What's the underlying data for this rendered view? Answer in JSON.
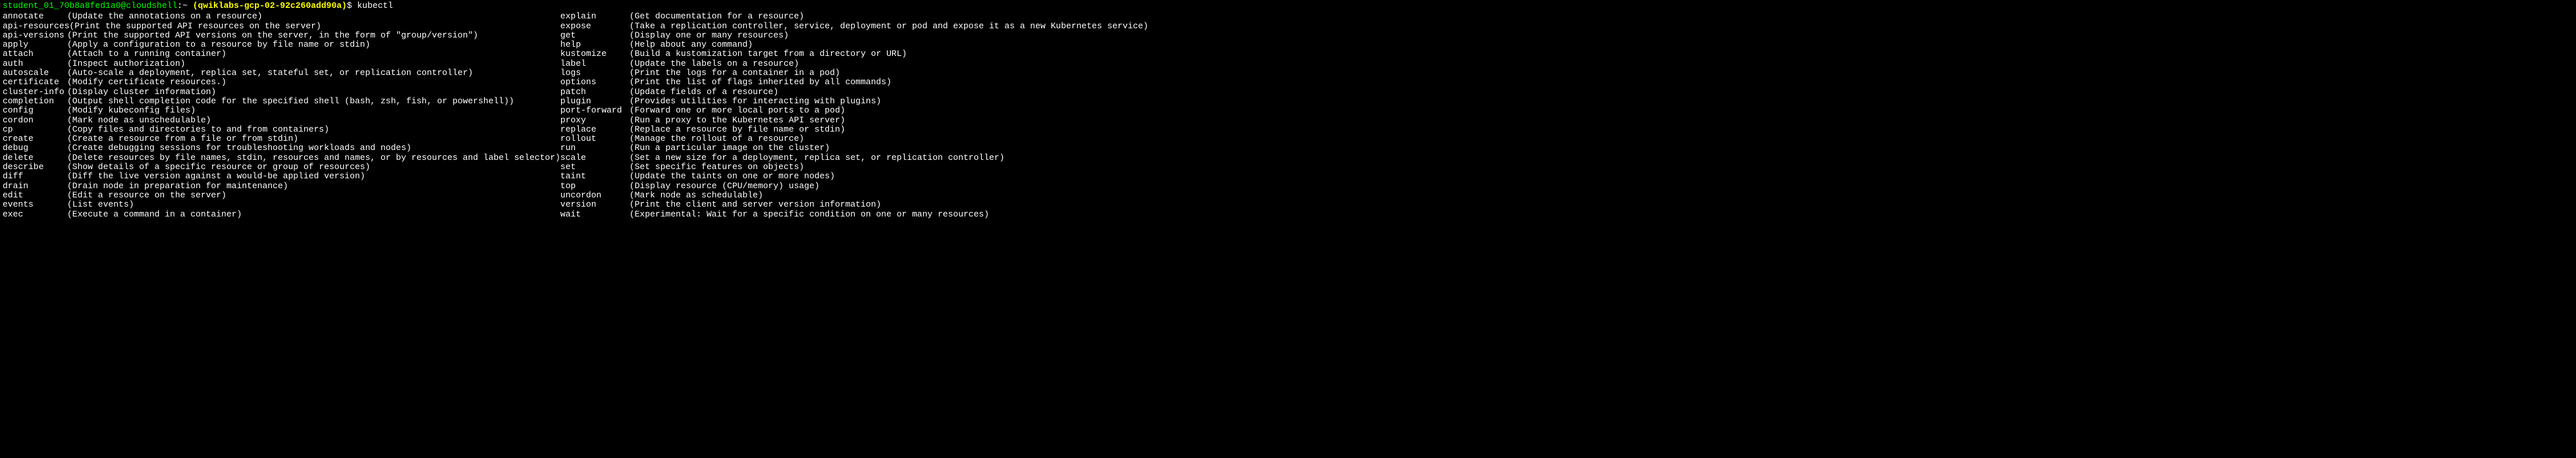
{
  "prompt": {
    "user": "student_01_70b8a8fed1a0@cloudshell",
    "separator": ":",
    "tilde": "~",
    "project": "(qwiklabs-gcp-02-92c260add90a)",
    "dollar": "$",
    "command": "kubectl"
  },
  "left_column": [
    {
      "name": "annotate",
      "desc": "(Update the annotations on a resource)"
    },
    {
      "name": "api-resources",
      "desc": "(Print the supported API resources on the server)"
    },
    {
      "name": "api-versions",
      "desc": "(Print the supported API versions on the server, in the form of \"group/version\")"
    },
    {
      "name": "apply",
      "desc": "(Apply a configuration to a resource by file name or stdin)"
    },
    {
      "name": "attach",
      "desc": "(Attach to a running container)"
    },
    {
      "name": "auth",
      "desc": "(Inspect authorization)"
    },
    {
      "name": "autoscale",
      "desc": "(Auto-scale a deployment, replica set, stateful set, or replication controller)"
    },
    {
      "name": "certificate",
      "desc": "(Modify certificate resources.)"
    },
    {
      "name": "cluster-info",
      "desc": "(Display cluster information)"
    },
    {
      "name": "completion",
      "desc": "(Output shell completion code for the specified shell (bash, zsh, fish, or powershell))"
    },
    {
      "name": "config",
      "desc": "(Modify kubeconfig files)"
    },
    {
      "name": "cordon",
      "desc": "(Mark node as unschedulable)"
    },
    {
      "name": "cp",
      "desc": "(Copy files and directories to and from containers)"
    },
    {
      "name": "create",
      "desc": "(Create a resource from a file or from stdin)"
    },
    {
      "name": "debug",
      "desc": "(Create debugging sessions for troubleshooting workloads and nodes)"
    },
    {
      "name": "delete",
      "desc": "(Delete resources by file names, stdin, resources and names, or by resources and label selector)"
    },
    {
      "name": "describe",
      "desc": "(Show details of a specific resource or group of resources)"
    },
    {
      "name": "diff",
      "desc": "(Diff the live version against a would-be applied version)"
    },
    {
      "name": "drain",
      "desc": "(Drain node in preparation for maintenance)"
    },
    {
      "name": "edit",
      "desc": "(Edit a resource on the server)"
    },
    {
      "name": "events",
      "desc": "(List events)"
    },
    {
      "name": "exec",
      "desc": "(Execute a command in a container)"
    }
  ],
  "right_column": [
    {
      "name": "explain",
      "desc": "(Get documentation for a resource)"
    },
    {
      "name": "expose",
      "desc": "(Take a replication controller, service, deployment or pod and expose it as a new Kubernetes service)"
    },
    {
      "name": "get",
      "desc": "(Display one or many resources)"
    },
    {
      "name": "help",
      "desc": "(Help about any command)"
    },
    {
      "name": "kustomize",
      "desc": "(Build a kustomization target from a directory or URL)"
    },
    {
      "name": "label",
      "desc": "(Update the labels on a resource)"
    },
    {
      "name": "logs",
      "desc": "(Print the logs for a container in a pod)"
    },
    {
      "name": "options",
      "desc": "(Print the list of flags inherited by all commands)"
    },
    {
      "name": "patch",
      "desc": "(Update fields of a resource)"
    },
    {
      "name": "plugin",
      "desc": "(Provides utilities for interacting with plugins)"
    },
    {
      "name": "port-forward",
      "desc": "(Forward one or more local ports to a pod)"
    },
    {
      "name": "proxy",
      "desc": "(Run a proxy to the Kubernetes API server)"
    },
    {
      "name": "replace",
      "desc": "(Replace a resource by file name or stdin)"
    },
    {
      "name": "rollout",
      "desc": "(Manage the rollout of a resource)"
    },
    {
      "name": "run",
      "desc": "(Run a particular image on the cluster)"
    },
    {
      "name": "scale",
      "desc": "(Set a new size for a deployment, replica set, or replication controller)"
    },
    {
      "name": "set",
      "desc": "(Set specific features on objects)"
    },
    {
      "name": "taint",
      "desc": "(Update the taints on one or more nodes)"
    },
    {
      "name": "top",
      "desc": "(Display resource (CPU/memory) usage)"
    },
    {
      "name": "uncordon",
      "desc": "(Mark node as schedulable)"
    },
    {
      "name": "version",
      "desc": "(Print the client and server version information)"
    },
    {
      "name": "wait",
      "desc": "(Experimental: Wait for a specific condition on one or many resources)"
    }
  ]
}
